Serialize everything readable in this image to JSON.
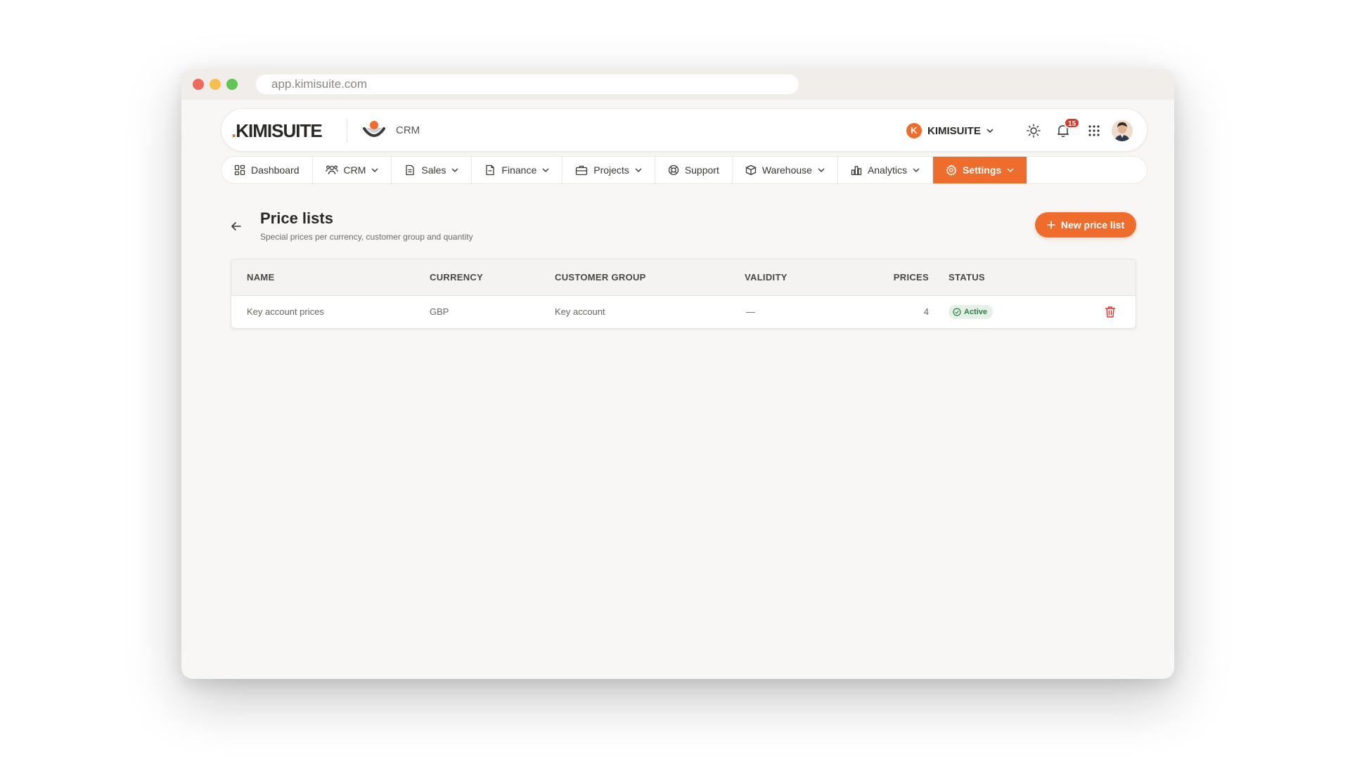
{
  "browser": {
    "url": "app.kimisuite.com"
  },
  "header": {
    "logo_text": "KIMISUITE",
    "module_label": "CRM",
    "tenant_initial": "K",
    "tenant_name": "KIMISUITE",
    "notification_count": "15"
  },
  "nav": {
    "items": [
      {
        "label": "Dashboard",
        "icon": "dashboard-icon",
        "has_dropdown": false
      },
      {
        "label": "CRM",
        "icon": "users-icon",
        "has_dropdown": true
      },
      {
        "label": "Sales",
        "icon": "document-icon",
        "has_dropdown": true
      },
      {
        "label": "Finance",
        "icon": "invoice-icon",
        "has_dropdown": true
      },
      {
        "label": "Projects",
        "icon": "briefcase-icon",
        "has_dropdown": true
      },
      {
        "label": "Support",
        "icon": "lifebuoy-icon",
        "has_dropdown": false
      },
      {
        "label": "Warehouse",
        "icon": "box-icon",
        "has_dropdown": true
      },
      {
        "label": "Analytics",
        "icon": "bar-chart-icon",
        "has_dropdown": true
      },
      {
        "label": "Settings",
        "icon": "gear-icon",
        "has_dropdown": true,
        "active": true
      }
    ]
  },
  "page": {
    "title": "Price lists",
    "subtitle": "Special prices per currency, customer group and quantity",
    "new_button_label": "New price list"
  },
  "table": {
    "columns": [
      "NAME",
      "CURRENCY",
      "CUSTOMER GROUP",
      "VALIDITY",
      "PRICES",
      "STATUS"
    ],
    "rows": [
      {
        "name": "Key account prices",
        "currency": "GBP",
        "customer_group": "Key account",
        "validity": "—",
        "prices": "4",
        "status": "Active"
      }
    ]
  },
  "colors": {
    "accent": "#ef6d2c",
    "active_status_bg": "#e5f1e7",
    "active_status_text": "#2e7d47",
    "danger": "#d9372a"
  }
}
